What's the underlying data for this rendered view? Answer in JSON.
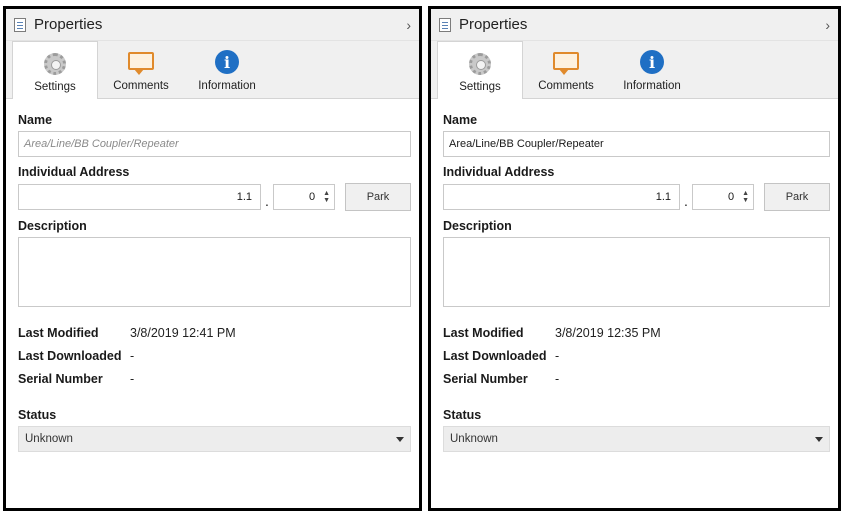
{
  "panels": [
    {
      "title": "Properties",
      "tabs": [
        "Settings",
        "Comments",
        "Information"
      ],
      "name_label": "Name",
      "name_value": "Area/Line/BB Coupler/Repeater",
      "address_label": "Individual Address",
      "address_main": "1.1",
      "address_dot": ".",
      "address_sub": "0",
      "park_label": "Park",
      "description_label": "Description",
      "last_modified_label": "Last Modified",
      "last_modified_value": "3/8/2019 12:41 PM",
      "last_downloaded_label": "Last Downloaded",
      "last_downloaded_value": "-",
      "serial_label": "Serial Number",
      "serial_value": "-",
      "status_label": "Status",
      "status_value": "Unknown"
    },
    {
      "title": "Properties",
      "tabs": [
        "Settings",
        "Comments",
        "Information"
      ],
      "name_label": "Name",
      "name_value": "Area/Line/BB Coupler/Repeater",
      "address_label": "Individual Address",
      "address_main": "1.1",
      "address_dot": ".",
      "address_sub": "0",
      "park_label": "Park",
      "description_label": "Description",
      "last_modified_label": "Last Modified",
      "last_modified_value": "3/8/2019 12:35 PM",
      "last_downloaded_label": "Last Downloaded",
      "last_downloaded_value": "-",
      "serial_label": "Serial Number",
      "serial_value": "-",
      "status_label": "Status",
      "status_value": "Unknown"
    }
  ],
  "icons": {
    "title": "properties-icon",
    "collapse": "chevron-right-icon",
    "tabs": [
      "gear-icon",
      "comment-icon",
      "info-icon"
    ],
    "spinner": "spinner-arrows-icon",
    "dropdown": "chevron-down-icon"
  },
  "info_glyph": "i",
  "chevron_glyph": "›",
  "spinner_up": "▲",
  "spinner_down": "▼"
}
